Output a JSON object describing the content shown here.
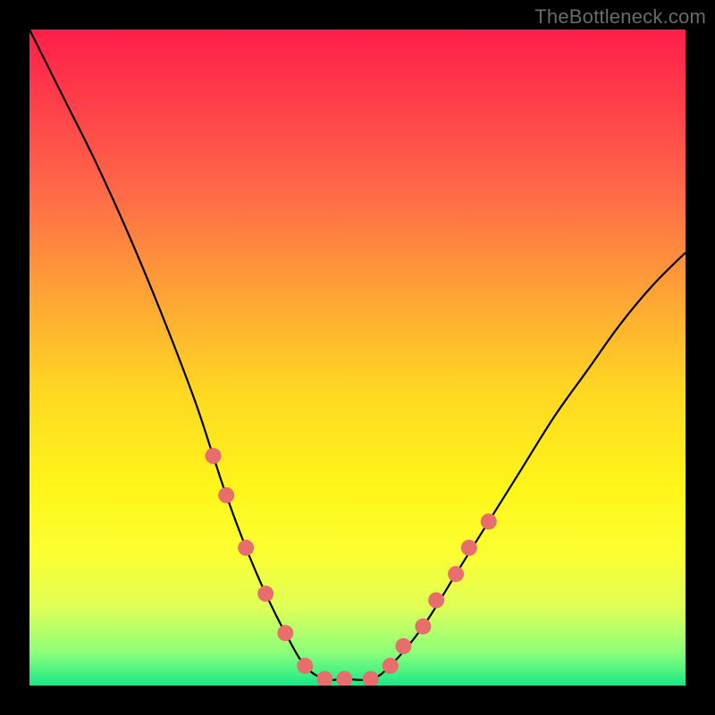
{
  "watermark": "TheBottleneck.com",
  "chart_data": {
    "type": "line",
    "title": "",
    "xlabel": "",
    "ylabel": "",
    "x_range": [
      0,
      100
    ],
    "y_range": [
      0,
      100
    ],
    "series": [
      {
        "name": "bottleneck-curve",
        "x": [
          0,
          5,
          10,
          15,
          20,
          25,
          28,
          30,
          33,
          36,
          39,
          42,
          45,
          48,
          52,
          55,
          60,
          65,
          70,
          75,
          80,
          85,
          90,
          95,
          100
        ],
        "y": [
          100,
          90,
          80,
          69,
          57,
          44,
          35,
          29,
          21,
          14,
          8,
          3,
          1,
          1,
          1,
          3,
          9,
          17,
          25,
          33,
          41,
          48,
          55,
          61,
          66
        ]
      }
    ],
    "markers": {
      "name": "highlighted-points",
      "color": "#e86d6d",
      "points": [
        {
          "x": 28,
          "y": 35
        },
        {
          "x": 30,
          "y": 29
        },
        {
          "x": 33,
          "y": 21
        },
        {
          "x": 36,
          "y": 14
        },
        {
          "x": 39,
          "y": 8
        },
        {
          "x": 42,
          "y": 3
        },
        {
          "x": 45,
          "y": 1
        },
        {
          "x": 48,
          "y": 1
        },
        {
          "x": 52,
          "y": 1
        },
        {
          "x": 55,
          "y": 3
        },
        {
          "x": 57,
          "y": 6
        },
        {
          "x": 60,
          "y": 9
        },
        {
          "x": 62,
          "y": 13
        },
        {
          "x": 65,
          "y": 17
        },
        {
          "x": 67,
          "y": 21
        },
        {
          "x": 70,
          "y": 25
        }
      ]
    }
  }
}
